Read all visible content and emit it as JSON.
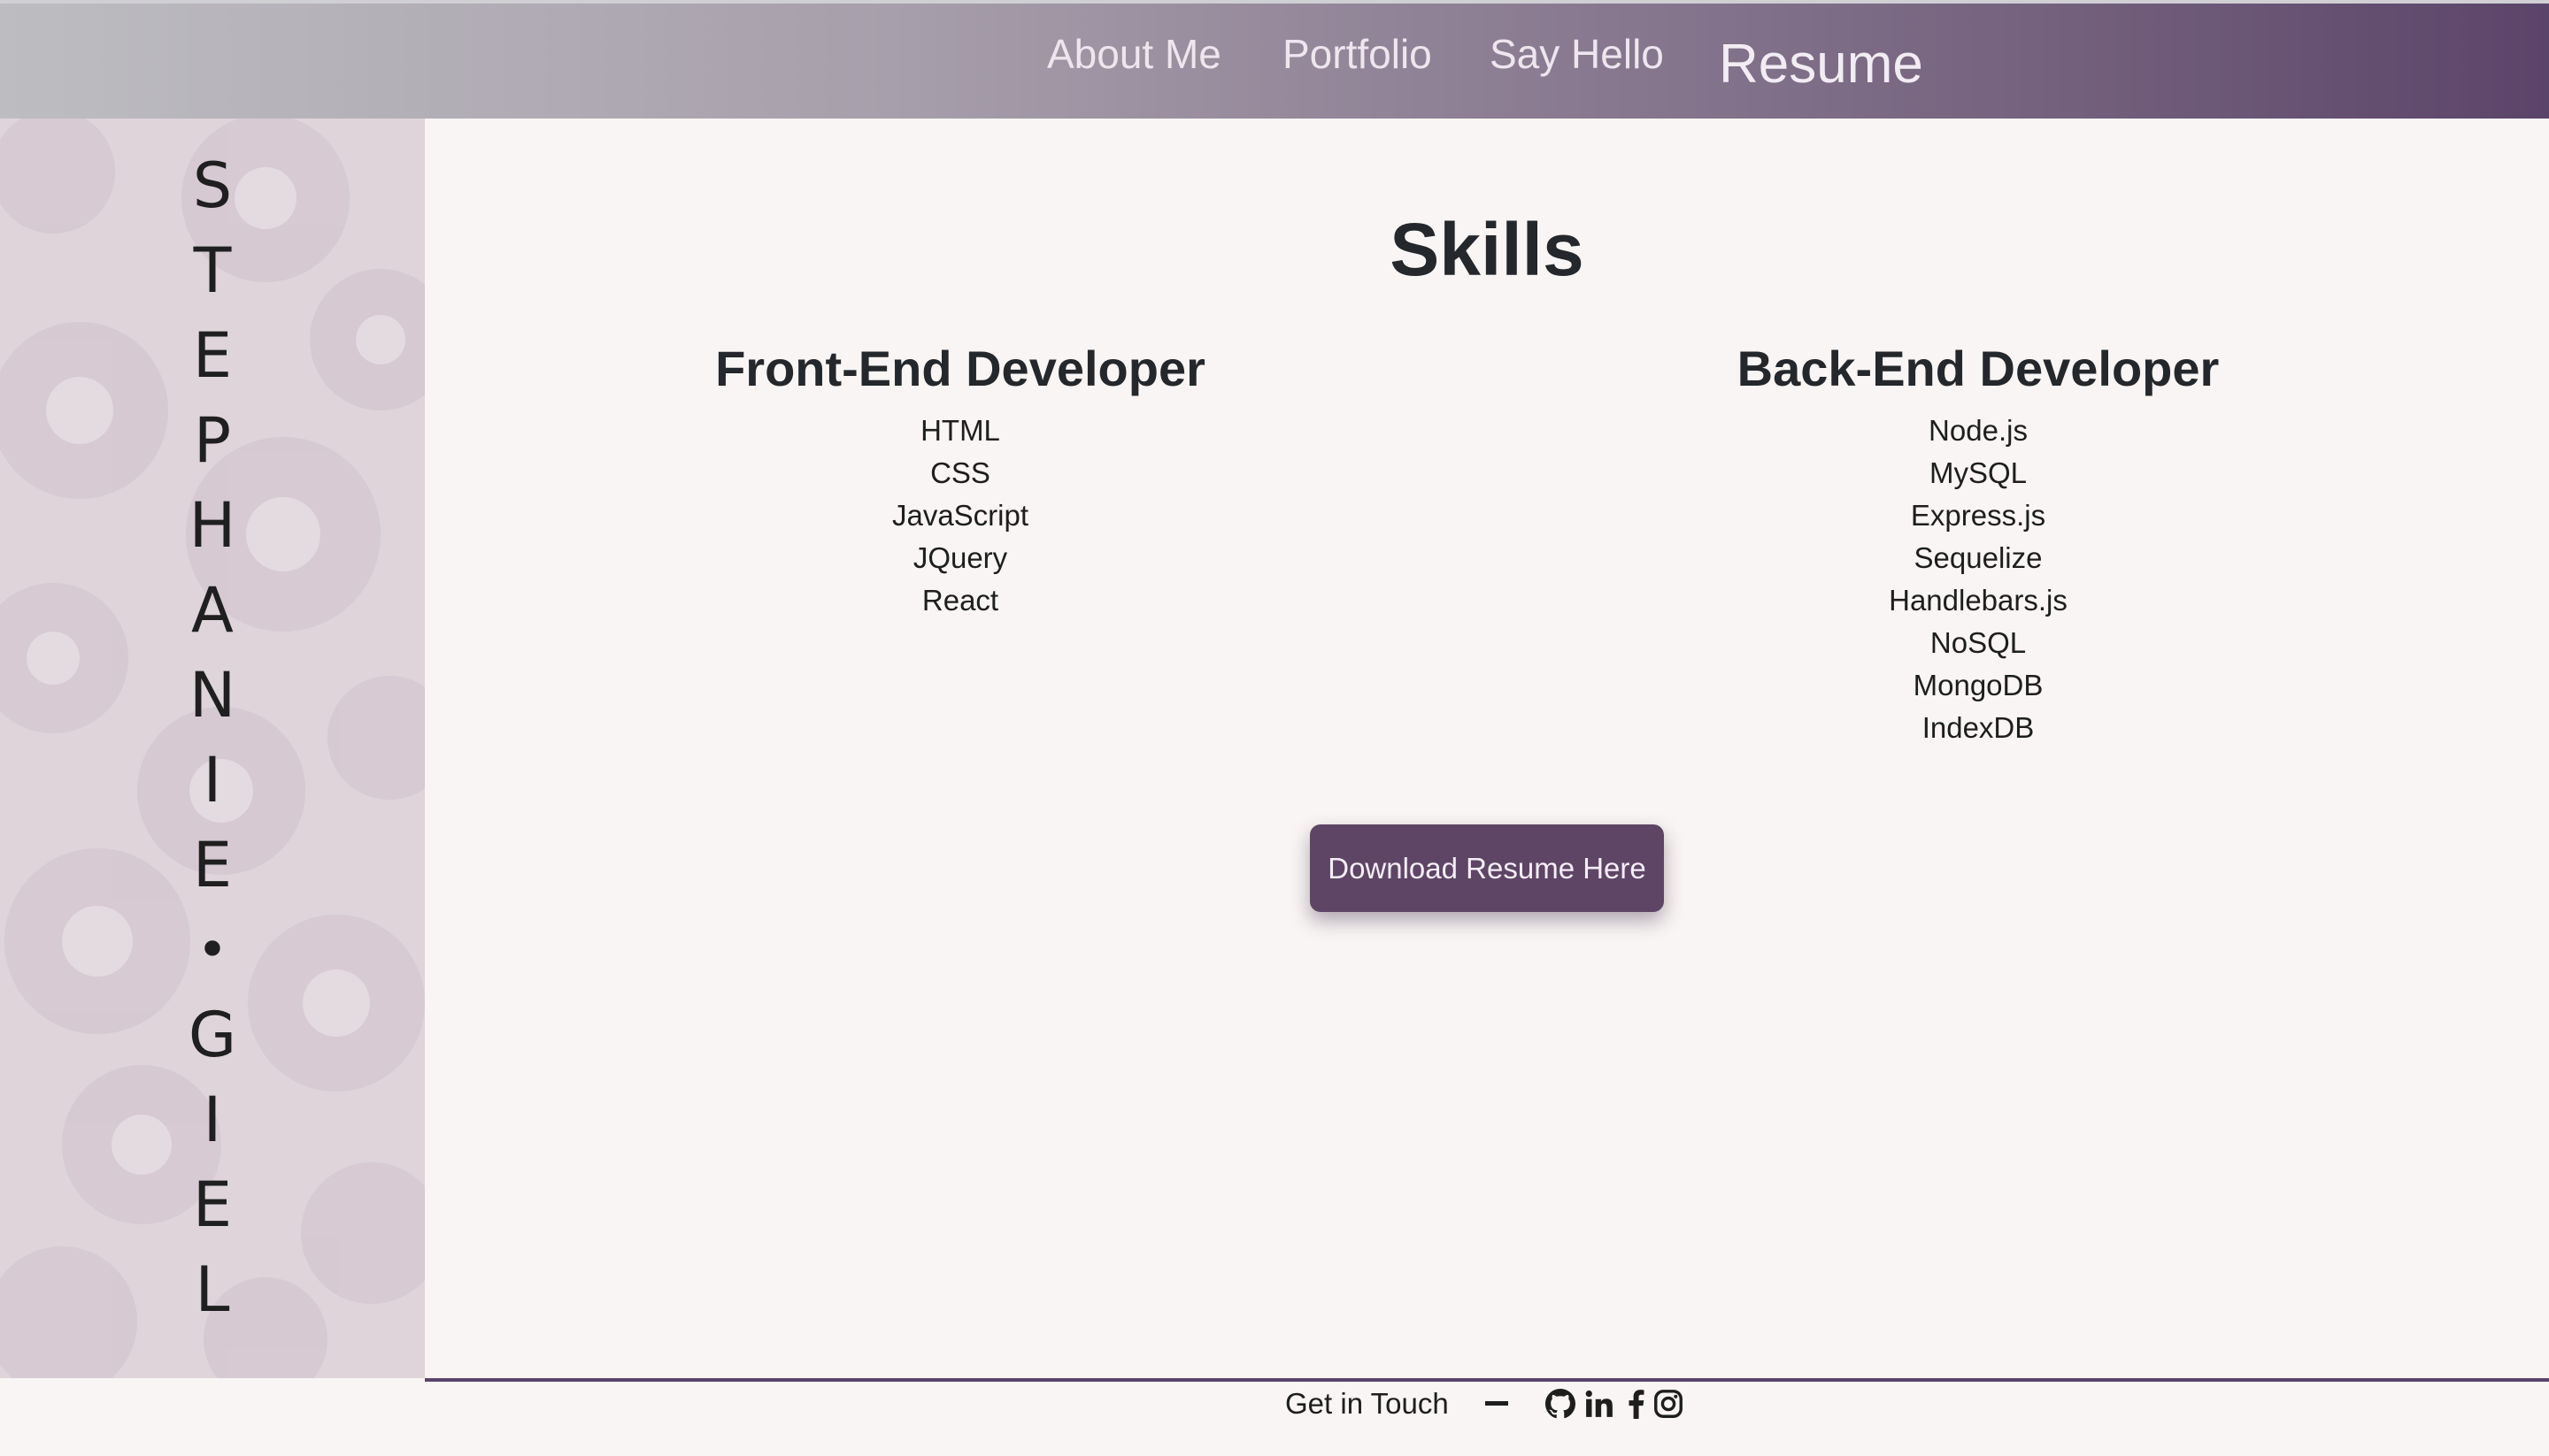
{
  "nav": {
    "items": [
      {
        "label": "About Me"
      },
      {
        "label": "Portfolio"
      },
      {
        "label": "Say Hello"
      },
      {
        "label": "Resume"
      }
    ]
  },
  "sidebar": {
    "name_letters": [
      "S",
      "T",
      "E",
      "P",
      "H",
      "A",
      "N",
      "I",
      "E",
      "•",
      "G",
      "I",
      "E",
      "L"
    ]
  },
  "skills": {
    "title": "Skills",
    "front_end": {
      "heading": "Front-End Developer",
      "items": [
        "HTML",
        "CSS",
        "JavaScript",
        "JQuery",
        "React"
      ]
    },
    "back_end": {
      "heading": "Back-End Developer",
      "items": [
        "Node.js",
        "MySQL",
        "Express.js",
        "Sequelize",
        "Handlebars.js",
        "NoSQL",
        "MongoDB",
        "IndexDB"
      ]
    },
    "download_label": "Download Resume Here"
  },
  "footer": {
    "text": "Get in Touch",
    "social_icons": [
      "github-icon",
      "linkedin-icon",
      "facebook-icon",
      "instagram-icon"
    ]
  },
  "colors": {
    "brand_purple": "#5e4565",
    "page_background": "#f8f5f4"
  }
}
